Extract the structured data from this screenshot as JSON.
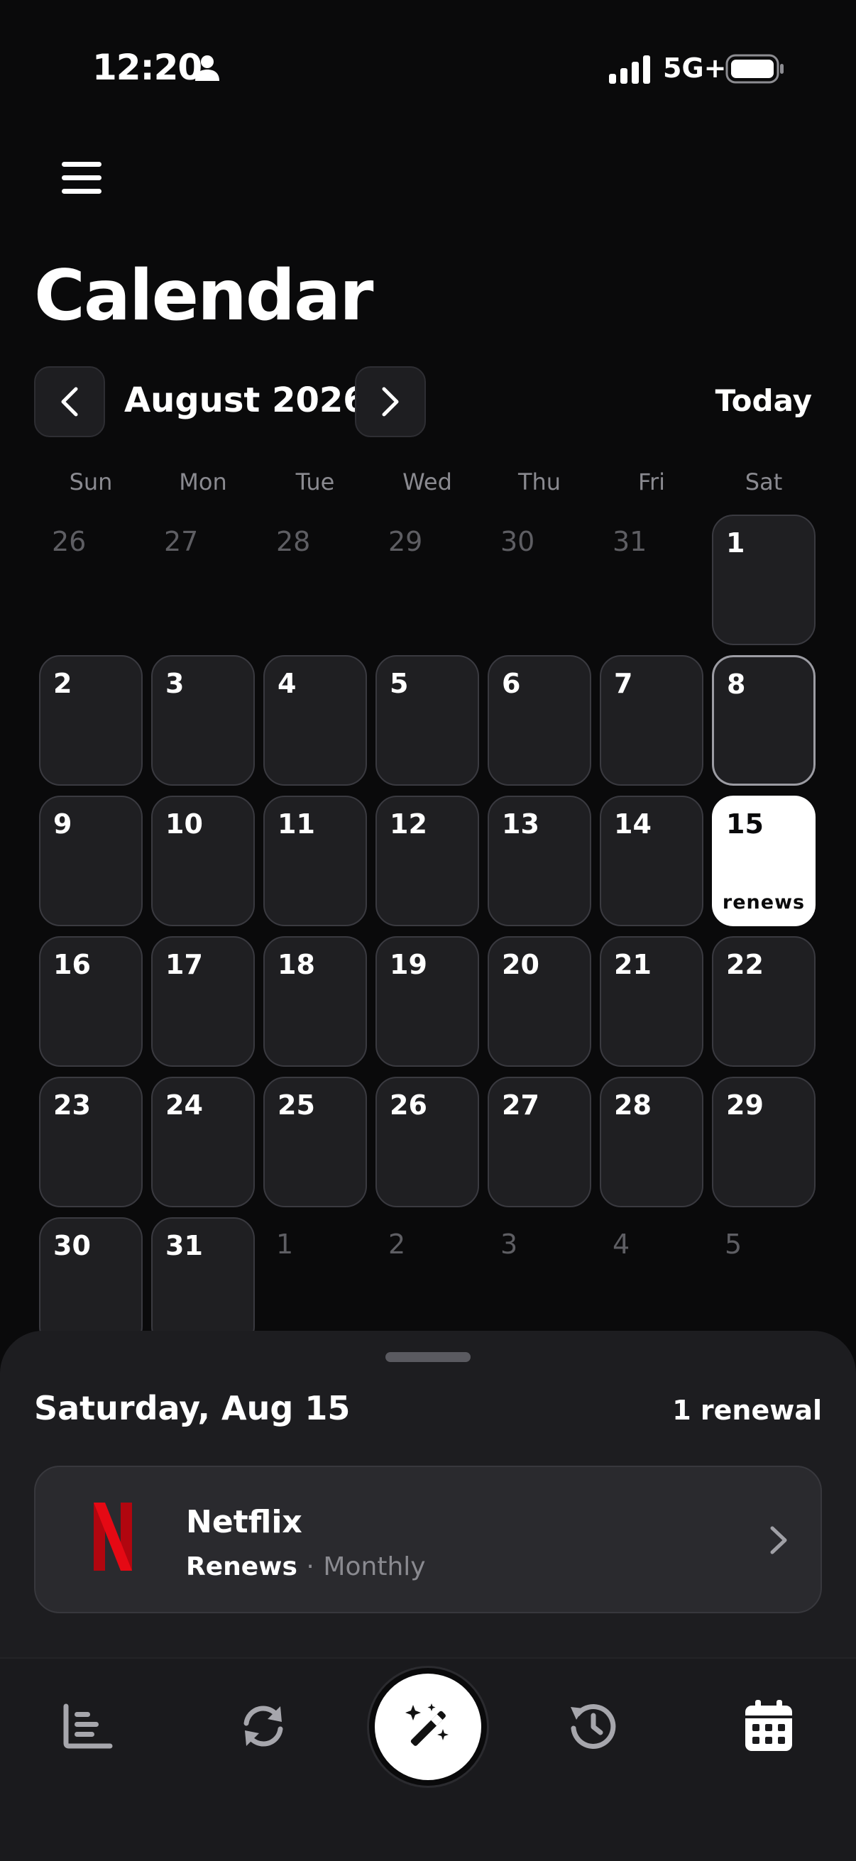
{
  "status_bar": {
    "time": "12:20",
    "network": "5G+",
    "icons": [
      "person-icon",
      "signal-icon",
      "battery-icon"
    ]
  },
  "header": {
    "menu_icon": "hamburger-menu-icon",
    "title": "Calendar"
  },
  "month_nav": {
    "label": "August 2026",
    "prev_icon": "chevron-left-icon",
    "next_icon": "chevron-right-icon",
    "today_label": "Today"
  },
  "weekdays": [
    "Sun",
    "Mon",
    "Tue",
    "Wed",
    "Thu",
    "Fri",
    "Sat"
  ],
  "calendar": {
    "weeks": [
      [
        {
          "day": "26",
          "in_month": false
        },
        {
          "day": "27",
          "in_month": false
        },
        {
          "day": "28",
          "in_month": false
        },
        {
          "day": "29",
          "in_month": false
        },
        {
          "day": "30",
          "in_month": false
        },
        {
          "day": "31",
          "in_month": false
        },
        {
          "day": "1",
          "in_month": true
        }
      ],
      [
        {
          "day": "2",
          "in_month": true
        },
        {
          "day": "3",
          "in_month": true
        },
        {
          "day": "4",
          "in_month": true
        },
        {
          "day": "5",
          "in_month": true
        },
        {
          "day": "6",
          "in_month": true
        },
        {
          "day": "7",
          "in_month": true
        },
        {
          "day": "8",
          "in_month": true,
          "today": true
        }
      ],
      [
        {
          "day": "9",
          "in_month": true
        },
        {
          "day": "10",
          "in_month": true
        },
        {
          "day": "11",
          "in_month": true
        },
        {
          "day": "12",
          "in_month": true
        },
        {
          "day": "13",
          "in_month": true
        },
        {
          "day": "14",
          "in_month": true
        },
        {
          "day": "15",
          "in_month": true,
          "selected": true,
          "badge": "renews"
        }
      ],
      [
        {
          "day": "16",
          "in_month": true
        },
        {
          "day": "17",
          "in_month": true
        },
        {
          "day": "18",
          "in_month": true
        },
        {
          "day": "19",
          "in_month": true
        },
        {
          "day": "20",
          "in_month": true
        },
        {
          "day": "21",
          "in_month": true
        },
        {
          "day": "22",
          "in_month": true
        }
      ],
      [
        {
          "day": "23",
          "in_month": true
        },
        {
          "day": "24",
          "in_month": true
        },
        {
          "day": "25",
          "in_month": true
        },
        {
          "day": "26",
          "in_month": true
        },
        {
          "day": "27",
          "in_month": true
        },
        {
          "day": "28",
          "in_month": true
        },
        {
          "day": "29",
          "in_month": true
        }
      ],
      [
        {
          "day": "30",
          "in_month": true
        },
        {
          "day": "31",
          "in_month": true
        },
        {
          "day": "1",
          "in_month": false
        },
        {
          "day": "2",
          "in_month": false
        },
        {
          "day": "3",
          "in_month": false
        },
        {
          "day": "4",
          "in_month": false
        },
        {
          "day": "5",
          "in_month": false
        }
      ]
    ]
  },
  "sheet": {
    "date_label": "Saturday, Aug 15",
    "count_label": "1 renewal",
    "items": [
      {
        "name": "Netflix",
        "status": "Renews",
        "separator": "·",
        "frequency": "Monthly",
        "logo_icon": "netflix-logo-icon",
        "logo_color": "#e50914"
      }
    ]
  },
  "tab_bar": {
    "tabs": [
      {
        "name": "stats",
        "icon": "bar-chart-icon"
      },
      {
        "name": "renewals",
        "icon": "refresh-icon"
      },
      {
        "name": "magic",
        "icon": "magic-wand-icon"
      },
      {
        "name": "history",
        "icon": "history-icon"
      },
      {
        "name": "calendar",
        "icon": "calendar-icon"
      }
    ]
  },
  "colors": {
    "background": "#0a0a0b",
    "cell": "#1f1f22",
    "selected": "#ffffff",
    "netflix_red": "#e50914"
  }
}
